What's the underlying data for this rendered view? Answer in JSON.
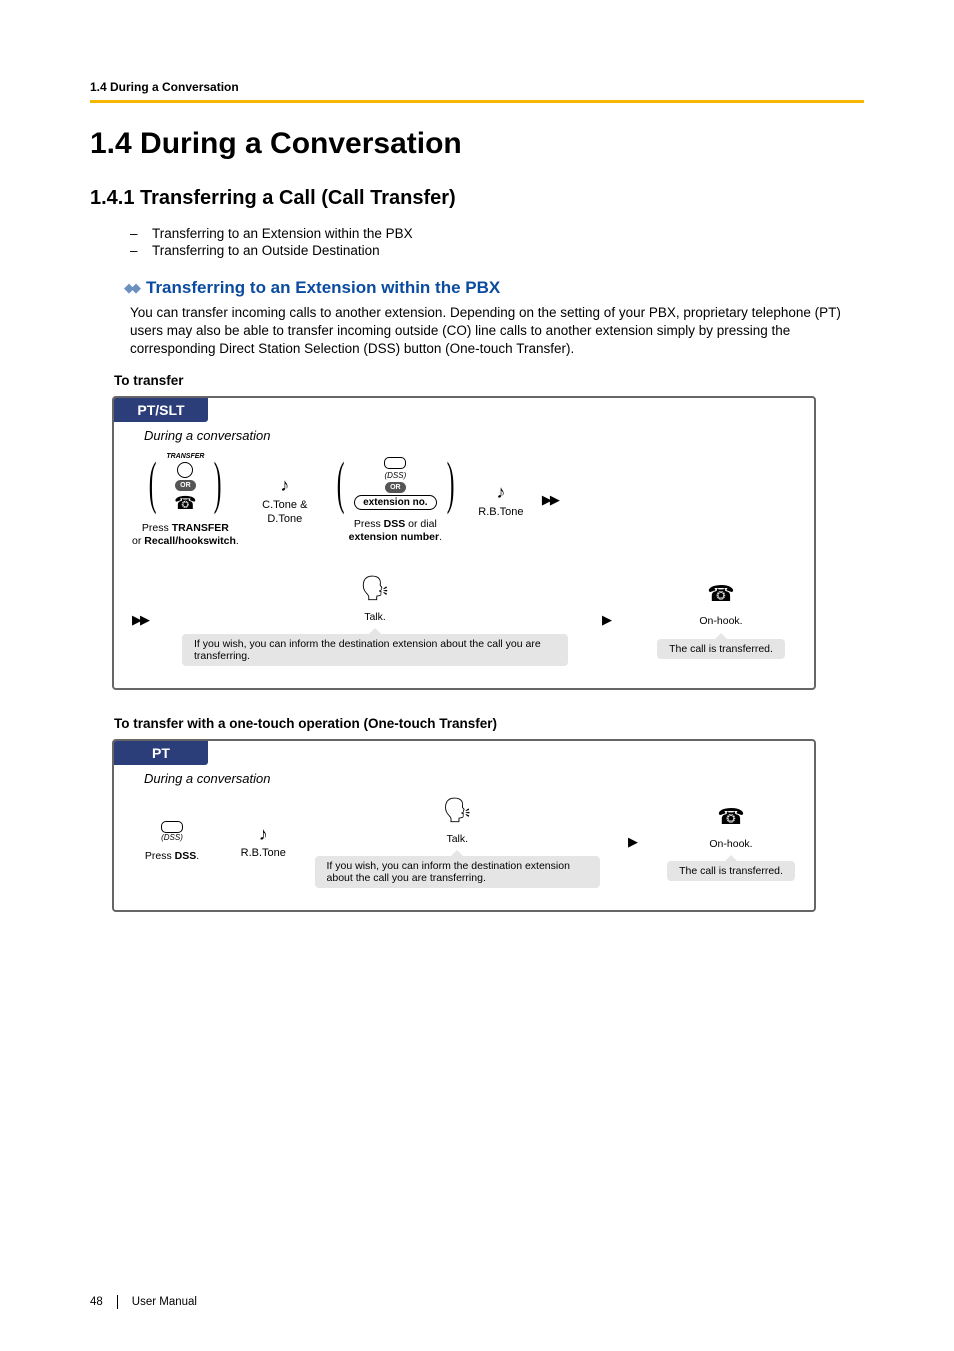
{
  "header": {
    "running": "1.4 During a Conversation"
  },
  "titles": {
    "section": "1.4   During a Conversation",
    "sub1": "1.4.1   Transferring a Call (Call Transfer)",
    "blue1": "Transferring to an Extension within the PBX"
  },
  "links": {
    "l1": "Transferring to an Extension within the PBX",
    "l2": "Transferring to an Outside Destination"
  },
  "para1": "You can transfer incoming calls to another extension. Depending on the setting of your PBX, proprietary telephone (PT) users may also be able to transfer incoming outside (CO) line calls to another extension simply by pressing the corresponding Direct Station Selection (DSS) button (One-touch Transfer).",
  "proc1_label": "To transfer",
  "proc2_label": "To transfer with a one-touch operation (One-touch Transfer)",
  "flow1": {
    "header": "PT/SLT",
    "condition": "During a conversation",
    "transfer_label": "TRANSFER",
    "or": "OR",
    "ctone_dtone": "C.Tone & D.Tone",
    "dss": "(DSS)",
    "ext_pill": "extension no.",
    "rbtone": "R.B.Tone",
    "instr1a": "Press ",
    "instr1b": "TRANSFER",
    "instr1c": " or ",
    "instr1d": "Recall/hookswitch",
    "instr1e": ".",
    "instr2a": "Press ",
    "instr2b": "DSS",
    "instr2c": " or dial ",
    "instr2d": "extension number",
    "instr2e": ".",
    "talk": "Talk.",
    "onhook": "On-hook.",
    "note1": "If you wish, you can inform the destination extension about the call you are transferring.",
    "note2": "The call is transferred."
  },
  "flow2": {
    "header": "PT",
    "condition": "During a conversation",
    "dss": "(DSS)",
    "rbtone": "R.B.Tone",
    "instr1a": "Press ",
    "instr1b": "DSS",
    "instr1c": ".",
    "talk": "Talk.",
    "onhook": "On-hook.",
    "note1": "If you wish, you can inform the destination extension about the call you are transferring.",
    "note2": "The call is transferred."
  },
  "footer": {
    "page": "48",
    "label": "User Manual"
  }
}
